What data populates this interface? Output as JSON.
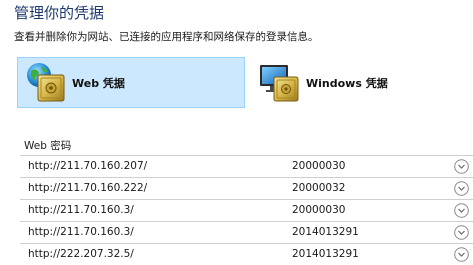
{
  "header": {
    "title": "管理你的凭据",
    "description": "查看并删除你为网站、已连接的应用程序和网络保存的登录信息。"
  },
  "tabs": [
    {
      "label": "Web 凭据",
      "icon": "globe-safe-icon",
      "selected": true
    },
    {
      "label": "Windows 凭据",
      "icon": "monitor-safe-icon",
      "selected": false
    }
  ],
  "section": {
    "label": "Web 密码"
  },
  "credentials": [
    {
      "url": "http://211.70.160.207/",
      "user": "20000030"
    },
    {
      "url": "http://211.70.160.222/",
      "user": "20000032"
    },
    {
      "url": "http://211.70.160.3/",
      "user": "20000030"
    },
    {
      "url": "http://211.70.160.3/",
      "user": "2014013291"
    },
    {
      "url": "http://222.207.32.5/",
      "user": "2014013291"
    }
  ],
  "colors": {
    "title": "#1e3a6e",
    "selected_tab_bg": "#cce8ff",
    "selected_tab_border": "#99d1ff",
    "row_divider": "#cfcfcf"
  }
}
